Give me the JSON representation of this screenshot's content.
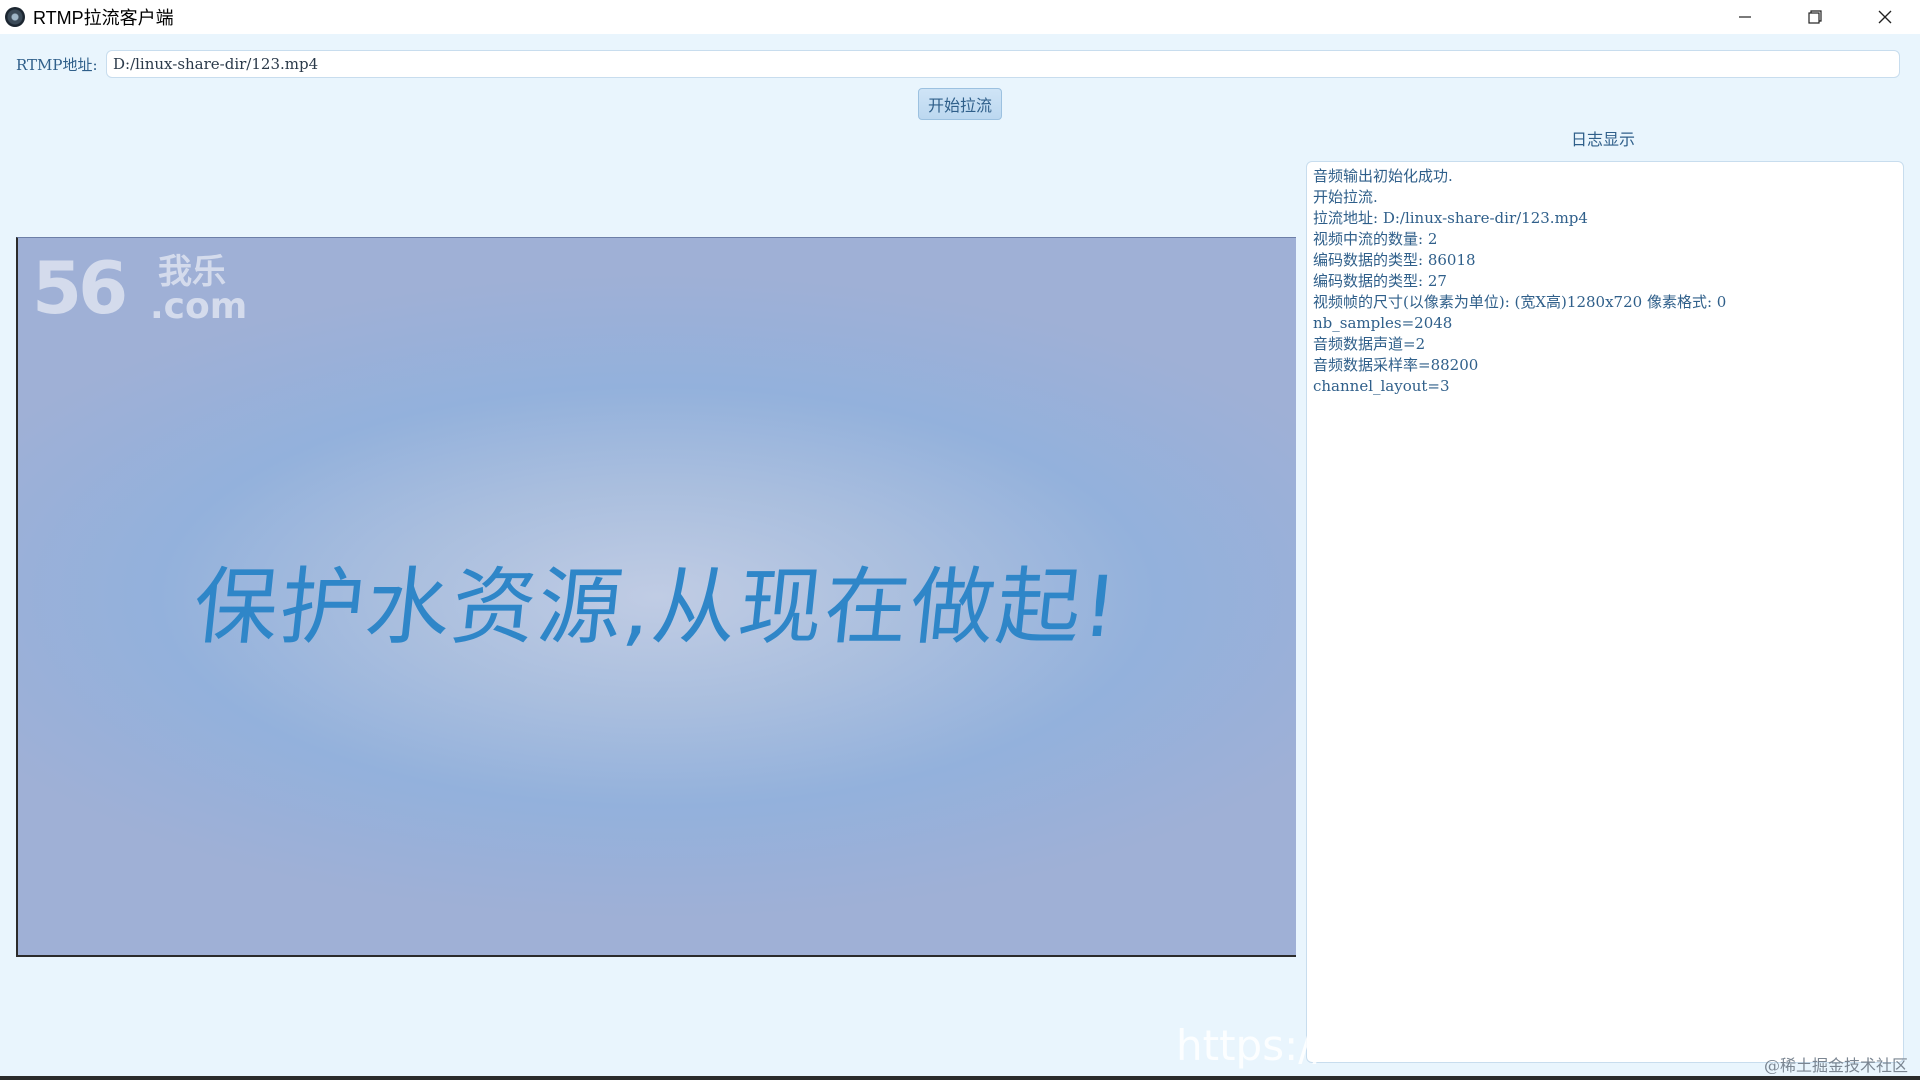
{
  "window": {
    "title": "RTMP拉流客户端",
    "app_icon": "camera-lens-icon",
    "controls": {
      "minimize_icon": "minimize-icon",
      "maximize_icon": "restore-icon",
      "close_icon": "close-icon"
    }
  },
  "address": {
    "label": "RTMP地址:",
    "value": "D:/linux-share-dir/123.mp4"
  },
  "start_button": {
    "label": "开始拉流"
  },
  "video": {
    "logo_number": "56",
    "logo_text": "我乐",
    "logo_domain": ".com",
    "caption": "保护水资源,从现在做起!"
  },
  "log": {
    "title": "日志显示",
    "lines": [
      "音频输出初始化成功.",
      "开始拉流.",
      "拉流地址: D:/linux-share-dir/123.mp4",
      "视频中流的数量: 2",
      "编码数据的类型: 86018",
      "编码数据的类型: 27",
      "视频帧的尺寸(以像素为单位): (宽X高)1280x720 像素格式: 0",
      "nb_samples=2048",
      "音频数据声道=2",
      "音频数据采样率=88200",
      "channel_layout=3"
    ]
  },
  "watermarks": {
    "url": "https://b",
    "juejin": "@稀土掘金技术社区"
  },
  "colors": {
    "window_bg": "#e9f5fd",
    "label_text": "#2f5f8a",
    "caption_text": "#2f86c8"
  }
}
